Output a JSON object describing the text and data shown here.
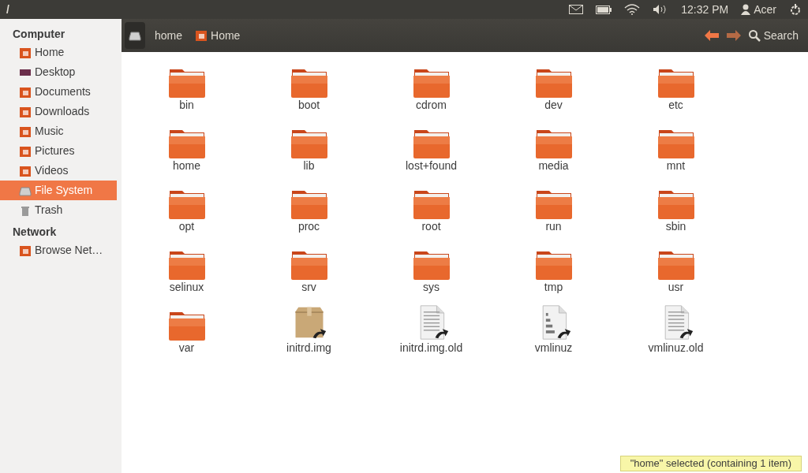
{
  "top_panel": {
    "title": "/",
    "clock": "12:32 PM",
    "user": "Acer"
  },
  "sidebar": {
    "sections": [
      {
        "heading": "Computer",
        "items": [
          {
            "label": "Home",
            "kind": "home",
            "selected": false
          },
          {
            "label": "Desktop",
            "kind": "desktop",
            "selected": false
          },
          {
            "label": "Documents",
            "kind": "documents",
            "selected": false
          },
          {
            "label": "Downloads",
            "kind": "downloads",
            "selected": false
          },
          {
            "label": "Music",
            "kind": "music",
            "selected": false
          },
          {
            "label": "Pictures",
            "kind": "pictures",
            "selected": false
          },
          {
            "label": "Videos",
            "kind": "videos",
            "selected": false
          },
          {
            "label": "File System",
            "kind": "drive",
            "selected": true
          },
          {
            "label": "Trash",
            "kind": "trash",
            "selected": false
          }
        ]
      },
      {
        "heading": "Network",
        "items": [
          {
            "label": "Browse Net…",
            "kind": "network",
            "selected": false
          }
        ]
      }
    ]
  },
  "toolbar": {
    "path": [
      {
        "label": "home",
        "kind": "plain"
      },
      {
        "label": "Home",
        "kind": "home"
      }
    ],
    "search": "Search"
  },
  "files": [
    {
      "name": "bin",
      "kind": "folder"
    },
    {
      "name": "boot",
      "kind": "folder"
    },
    {
      "name": "cdrom",
      "kind": "folder"
    },
    {
      "name": "dev",
      "kind": "folder"
    },
    {
      "name": "etc",
      "kind": "folder"
    },
    {
      "name": "home",
      "kind": "folder"
    },
    {
      "name": "lib",
      "kind": "folder"
    },
    {
      "name": "lost+found",
      "kind": "folder"
    },
    {
      "name": "media",
      "kind": "folder"
    },
    {
      "name": "mnt",
      "kind": "folder"
    },
    {
      "name": "opt",
      "kind": "folder"
    },
    {
      "name": "proc",
      "kind": "folder"
    },
    {
      "name": "root",
      "kind": "folder"
    },
    {
      "name": "run",
      "kind": "folder"
    },
    {
      "name": "sbin",
      "kind": "folder"
    },
    {
      "name": "selinux",
      "kind": "folder"
    },
    {
      "name": "srv",
      "kind": "folder"
    },
    {
      "name": "sys",
      "kind": "folder"
    },
    {
      "name": "tmp",
      "kind": "folder"
    },
    {
      "name": "usr",
      "kind": "folder"
    },
    {
      "name": "var",
      "kind": "folder"
    },
    {
      "name": "initrd.img",
      "kind": "archive"
    },
    {
      "name": "initrd.img.old",
      "kind": "text"
    },
    {
      "name": "vmlinuz",
      "kind": "binary"
    },
    {
      "name": "vmlinuz.old",
      "kind": "text"
    }
  ],
  "status": "\"home\" selected (containing 1 item)"
}
